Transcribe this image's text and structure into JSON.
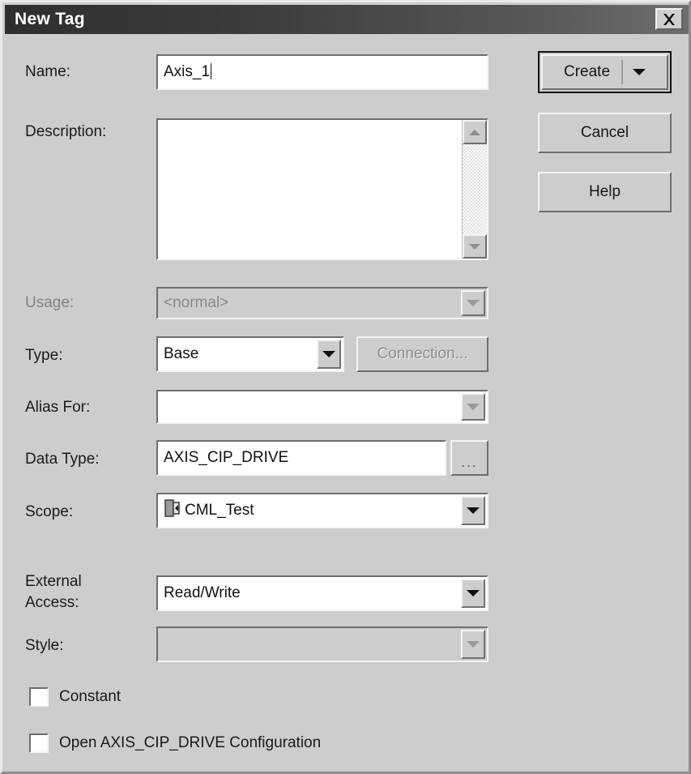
{
  "window": {
    "title": "New Tag",
    "close_icon": "close-x-icon"
  },
  "form": {
    "name": {
      "label": "Name:",
      "value": "Axis_1",
      "placeholder": ""
    },
    "description": {
      "label": "Description:",
      "value": "",
      "placeholder": "",
      "scroll_up_icon": "triangle-up-icon",
      "scroll_down_icon": "triangle-down-icon"
    },
    "usage": {
      "label": "Usage:",
      "value": "<normal>",
      "enabled": false,
      "dropdown_icon": "chevron-down-icon"
    },
    "type": {
      "label": "Type:",
      "value": "Base",
      "enabled": true,
      "dropdown_icon": "chevron-down-icon",
      "connection_button": "Connection...",
      "connection_enabled": false
    },
    "alias_for": {
      "label": "Alias For:",
      "value": "",
      "enabled": false,
      "dropdown_icon": "chevron-down-icon"
    },
    "data_type": {
      "label": "Data Type:",
      "value": "AXIS_CIP_DRIVE",
      "browse_button": "...",
      "enabled": true
    },
    "scope": {
      "label": "Scope:",
      "value": "CML_Test",
      "icon": "controller-icon",
      "enabled": true,
      "dropdown_icon": "chevron-down-icon"
    },
    "external_access": {
      "label": "External\nAccess:",
      "label_line1": "External",
      "label_line2": "Access:",
      "value": "Read/Write",
      "enabled": true,
      "dropdown_icon": "chevron-down-icon"
    },
    "style": {
      "label": "Style:",
      "value": "",
      "enabled": false,
      "dropdown_icon": "chevron-down-icon"
    },
    "constant": {
      "label": "Constant",
      "checked": false
    },
    "open_config": {
      "label": "Open AXIS_CIP_DRIVE Configuration",
      "checked": false
    }
  },
  "buttons": {
    "create": "Create",
    "create_dropdown_icon": "chevron-down-icon",
    "cancel": "Cancel",
    "help": "Help"
  },
  "colors": {
    "dialog_face": "#cdcdcd",
    "titlebar_start": "#2e2e2e",
    "titlebar_end": "#6d6d6d",
    "field_bg": "#ffffff",
    "text": "#1a1a1a",
    "disabled_text": "#8a8a8a"
  }
}
